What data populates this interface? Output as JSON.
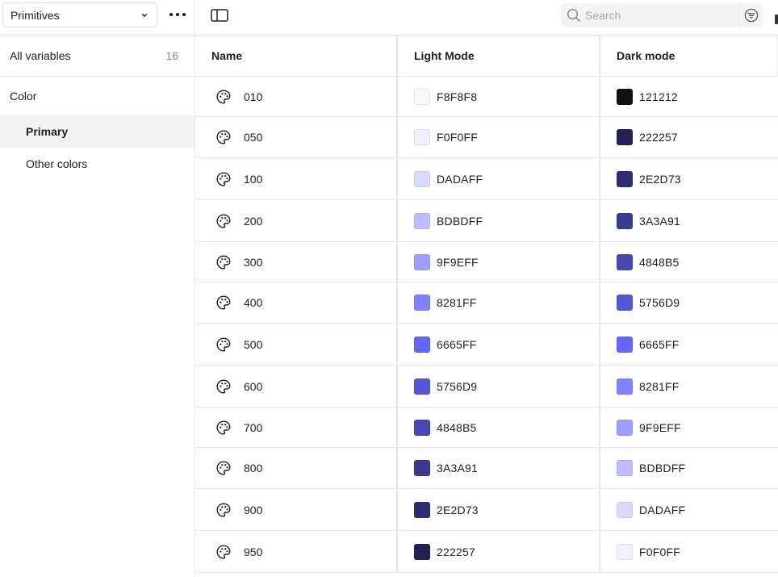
{
  "sidebar": {
    "collection_label": "Primitives",
    "all_variables": {
      "label": "All variables",
      "count": "16"
    },
    "group": "Color",
    "items": [
      {
        "label": "Primary",
        "active": true
      },
      {
        "label": "Other colors",
        "active": false
      }
    ]
  },
  "search": {
    "placeholder": "Search"
  },
  "table": {
    "headers": {
      "name": "Name",
      "light": "Light Mode",
      "dark": "Dark mode"
    },
    "rows": [
      {
        "name": "010",
        "light": "F8F8F8",
        "dark": "121212"
      },
      {
        "name": "050",
        "light": "F0F0FF",
        "dark": "222257"
      },
      {
        "name": "100",
        "light": "DADAFF",
        "dark": "2E2D73"
      },
      {
        "name": "200",
        "light": "BDBDFF",
        "dark": "3A3A91"
      },
      {
        "name": "300",
        "light": "9F9EFF",
        "dark": "4848B5"
      },
      {
        "name": "400",
        "light": "8281FF",
        "dark": "5756D9"
      },
      {
        "name": "500",
        "light": "6665FF",
        "dark": "6665FF"
      },
      {
        "name": "600",
        "light": "5756D9",
        "dark": "8281FF"
      },
      {
        "name": "700",
        "light": "4848B5",
        "dark": "9F9EFF"
      },
      {
        "name": "800",
        "light": "3A3A91",
        "dark": "BDBDFF"
      },
      {
        "name": "900",
        "light": "2E2D73",
        "dark": "DADAFF"
      },
      {
        "name": "950",
        "light": "222257",
        "dark": "F0F0FF"
      }
    ]
  },
  "icons": {
    "collection_dropdown": "chevron-down-icon",
    "more": "more-horizontal-icon",
    "panel": "sidebar-toggle-icon",
    "search": "search-icon",
    "filter": "filter-icon",
    "variable": "palette-icon"
  }
}
